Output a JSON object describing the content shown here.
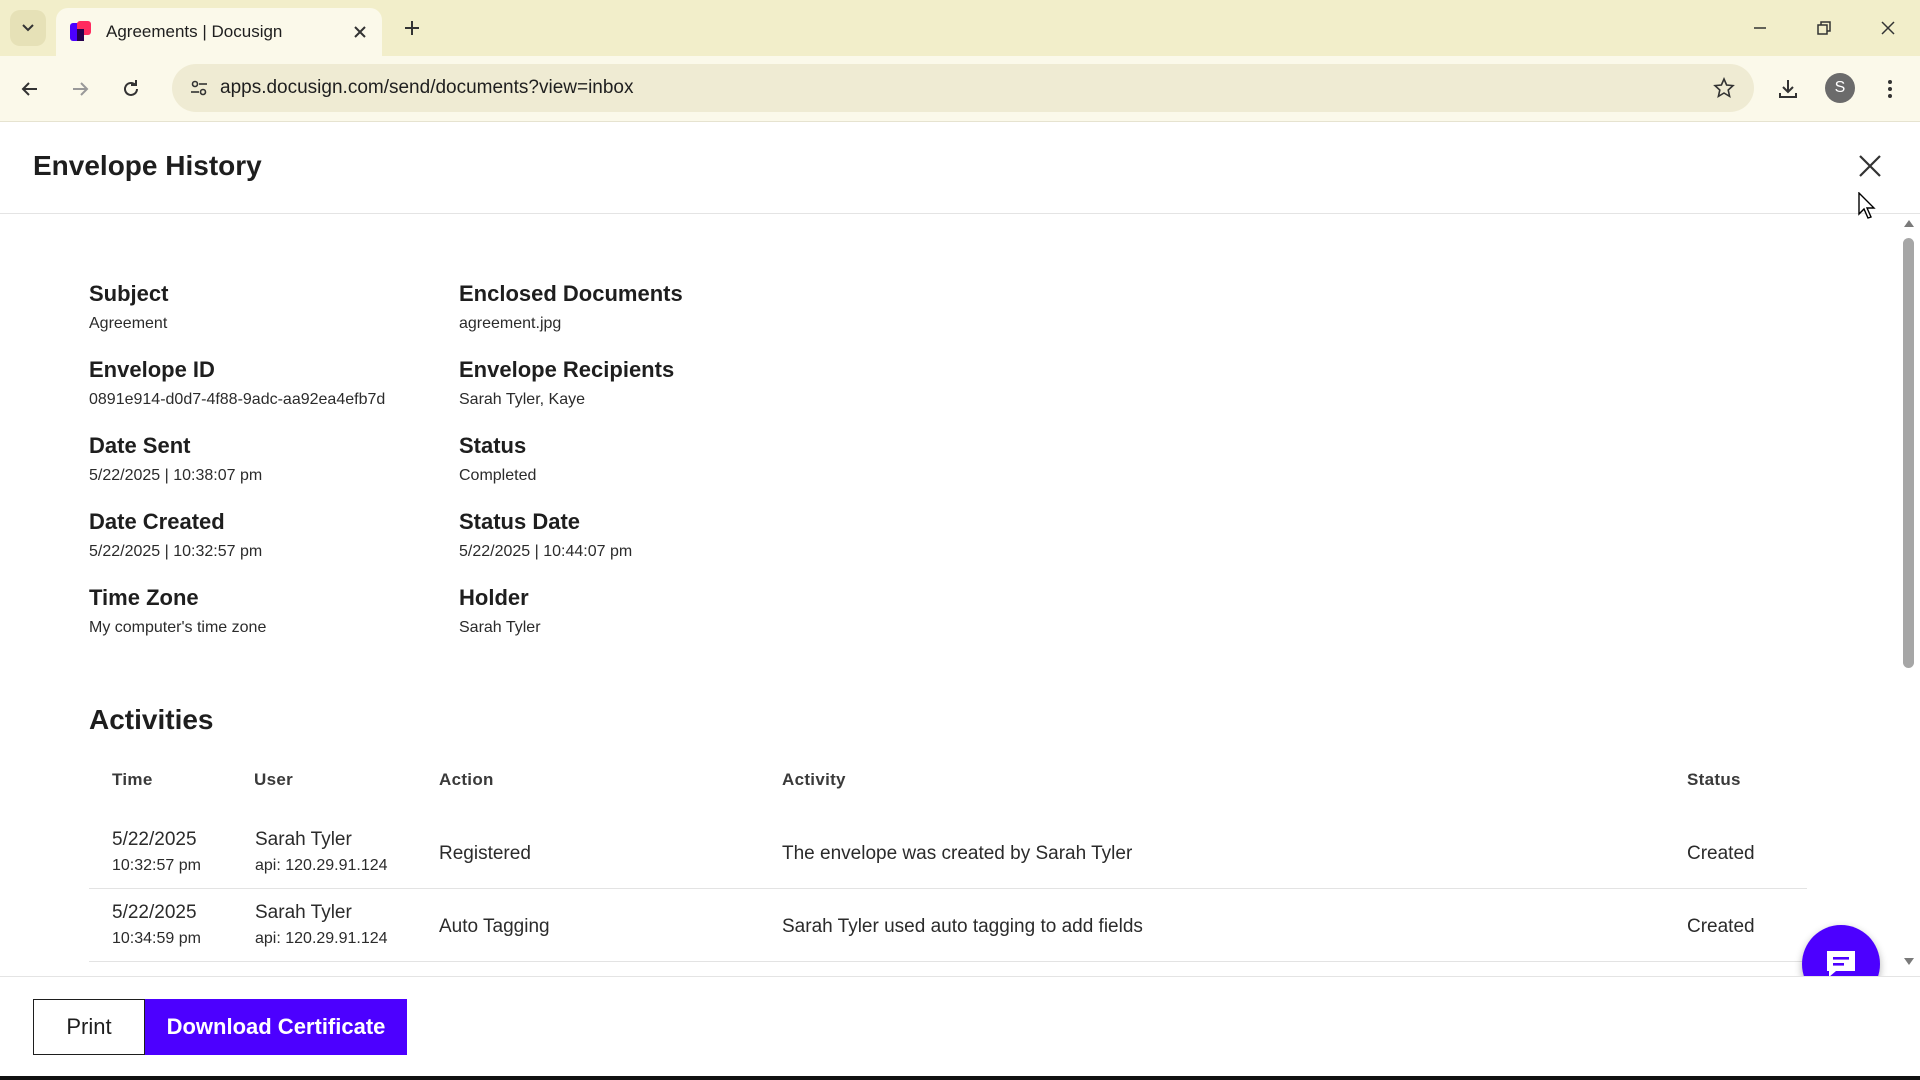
{
  "browser": {
    "tab_title": "Agreements | Docusign",
    "url": "apps.docusign.com/send/documents?view=inbox",
    "profile_initial": "S"
  },
  "panel": {
    "title": "Envelope History"
  },
  "details": {
    "subject": {
      "label": "Subject",
      "value": "Agreement"
    },
    "enclosed_documents": {
      "label": "Enclosed Documents",
      "value": "agreement.jpg"
    },
    "envelope_id": {
      "label": "Envelope ID",
      "value": "0891e914-d0d7-4f88-9adc-aa92ea4efb7d"
    },
    "envelope_recipients": {
      "label": "Envelope Recipients",
      "value": "Sarah Tyler, Kaye"
    },
    "date_sent": {
      "label": "Date Sent",
      "value": "5/22/2025 | 10:38:07 pm"
    },
    "status": {
      "label": "Status",
      "value": "Completed"
    },
    "date_created": {
      "label": "Date Created",
      "value": "5/22/2025 | 10:32:57 pm"
    },
    "status_date": {
      "label": "Status Date",
      "value": "5/22/2025 | 10:44:07 pm"
    },
    "time_zone": {
      "label": "Time Zone",
      "value": "My computer's time zone"
    },
    "holder": {
      "label": "Holder",
      "value": "Sarah Tyler"
    }
  },
  "activities": {
    "title": "Activities",
    "columns": {
      "time": "Time",
      "user": "User",
      "action": "Action",
      "activity": "Activity",
      "status": "Status"
    },
    "rows": [
      {
        "date": "5/22/2025",
        "time": "10:32:57 pm",
        "user": "Sarah Tyler",
        "api": "api: 120.29.91.124",
        "action": "Registered",
        "activity": "The envelope was created by Sarah Tyler",
        "status": "Created"
      },
      {
        "date": "5/22/2025",
        "time": "10:34:59 pm",
        "user": "Sarah Tyler",
        "api": "api: 120.29.91.124",
        "action": "Auto Tagging",
        "activity": "Sarah Tyler used auto tagging to add fields",
        "status": "Created"
      }
    ]
  },
  "footer": {
    "print_label": "Print",
    "download_label": "Download Certificate"
  },
  "colors": {
    "brand": "#4c00ff",
    "tabbar_bg": "#f2eeca",
    "toolbar_bg": "#fbf9ea"
  }
}
